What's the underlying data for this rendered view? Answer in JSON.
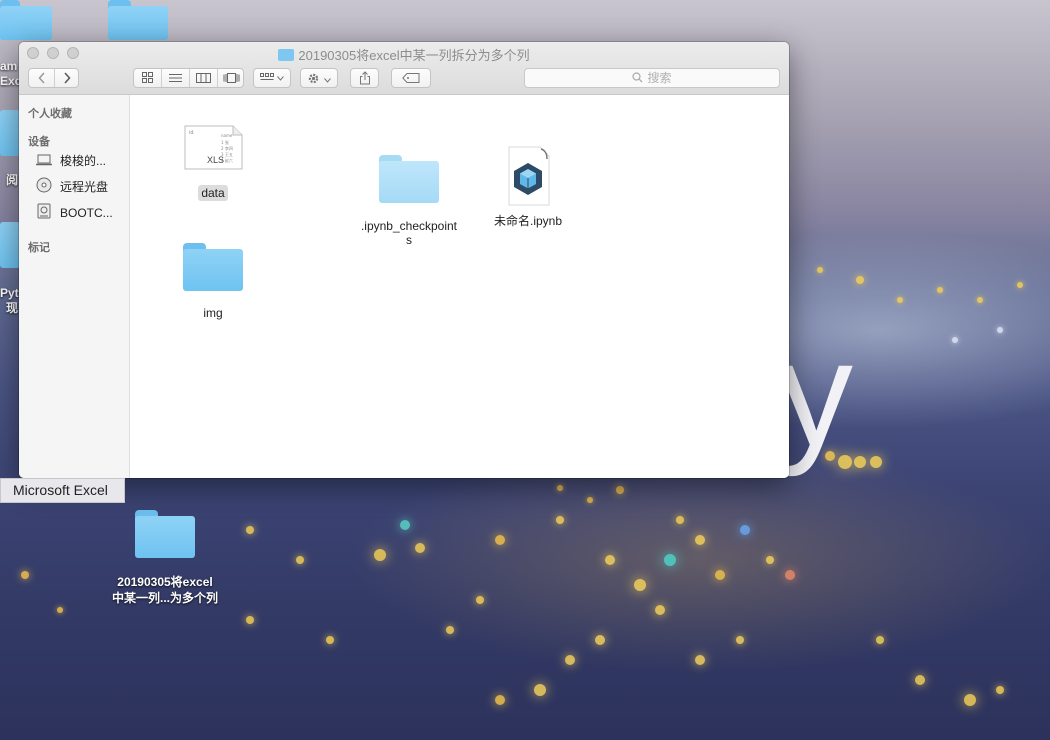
{
  "desktop": {
    "partial_labels": [
      "am",
      "Exc",
      "阅",
      "Pyt",
      "现"
    ],
    "folder": {
      "name": "20190305将excel中某一列...为多个列",
      "name_line1": "20190305将excel",
      "name_line2": "中某一列...为多个列",
      "icon": "folder-icon"
    },
    "wallpaper_letter": "y",
    "tooltip": "Microsoft Excel"
  },
  "window": {
    "title": "20190305将excel中某一列拆分为多个列",
    "toolbar": {
      "back_icon": "chevron-left-icon",
      "forward_icon": "chevron-right-icon",
      "view_icons": [
        "icon-view-icon",
        "list-view-icon",
        "column-view-icon",
        "cover-flow-icon"
      ],
      "arrange_icon": "arrange-grid-icon",
      "action_icon": "gear-icon",
      "share_icon": "share-icon",
      "tag_icon": "tag-icon",
      "search_placeholder": "搜索"
    },
    "sidebar": {
      "favorites_heading": "个人收藏",
      "devices_heading": "设备",
      "devices": [
        {
          "label": "梭梭的...",
          "icon": "laptop-icon"
        },
        {
          "label": "远程光盘",
          "icon": "disc-icon"
        },
        {
          "label": "BOOTC...",
          "icon": "drive-icon"
        }
      ],
      "tags_heading": "标记"
    },
    "files": [
      {
        "name": "data",
        "icon": "xls-file-icon",
        "badge": "XLS",
        "selected": true
      },
      {
        "name": ".ipynb_checkpoints",
        "name_line1": ".ipynb_checkpoint",
        "name_line2": "s",
        "icon": "folder-icon"
      },
      {
        "name": "未命名.ipynb",
        "icon": "jupyter-notebook-icon"
      },
      {
        "name": "img",
        "icon": "folder-icon"
      }
    ]
  }
}
